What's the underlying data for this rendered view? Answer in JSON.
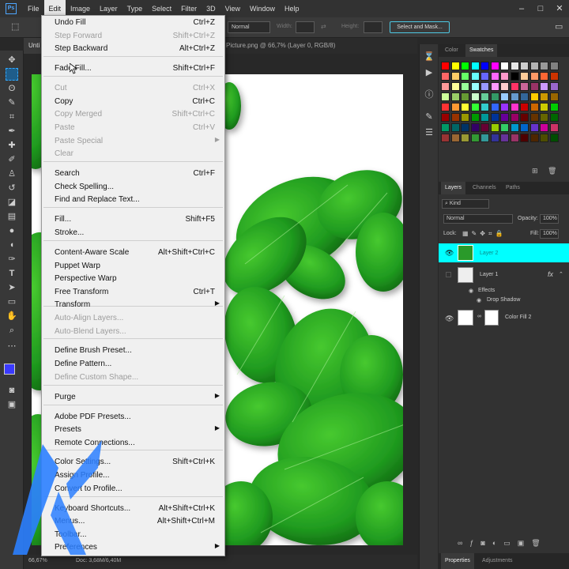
{
  "menubar": {
    "logo": "Ps",
    "items": [
      "File",
      "Edit",
      "Image",
      "Layer",
      "Type",
      "Select",
      "Filter",
      "3D",
      "View",
      "Window",
      "Help"
    ]
  },
  "options": {
    "mode": "Normal",
    "width_label": "Width:",
    "height_label": "Height:",
    "select_mask": "Select and Mask..."
  },
  "tabs": {
    "doc1": "Unti",
    "doc2": "Picture.png @ 66,7% (Layer 0, RGB/8)"
  },
  "status": {
    "zoom": "66,67%",
    "doc": "Doc: 3,68M/6,40M"
  },
  "panels": {
    "color_tab": "Color",
    "swatches_tab": "Swatches",
    "layers_tab": "Layers",
    "channels_tab": "Channels",
    "paths_tab": "Paths",
    "kind": "Kind",
    "blend": "Normal",
    "opacity_label": "Opacity:",
    "opacity_value": "100%",
    "lock_label": "Lock:",
    "fill_label": "Fill:",
    "fill_value": "100%",
    "properties_tab": "Properties",
    "adjustments_tab": "Adjustments"
  },
  "layers": [
    {
      "name": "Layer 2",
      "selected": true
    },
    {
      "name": "Layer 1",
      "fx": "fx"
    },
    {
      "name": "Effects"
    },
    {
      "name": "Drop Shadow"
    },
    {
      "name": "Color Fill 2"
    }
  ],
  "swatch_colors": [
    [
      "#ff0000",
      "#ffff00",
      "#00ff00",
      "#00ffff",
      "#0000ff",
      "#ff00ff",
      "#ffffff",
      "#e6e6e6",
      "#cccccc",
      "#b3b3b3",
      "#999999",
      "#808080"
    ],
    [
      "#ff6666",
      "#ffcc66",
      "#66ff66",
      "#66ffff",
      "#6666ff",
      "#ff66ff",
      "#ff99cc",
      "#000000",
      "#ffcc99",
      "#ff9966",
      "#ff6633",
      "#cc3300"
    ],
    [
      "#ff9999",
      "#ffff99",
      "#99ff99",
      "#99ffff",
      "#9999ff",
      "#ff99ff",
      "#ffcccc",
      "#ff3366",
      "#cc6699",
      "#993366",
      "#cc99ff",
      "#9966cc"
    ],
    [
      "#ccff99",
      "#99cc66",
      "#669933",
      "#ccffcc",
      "#66cc99",
      "#339966",
      "#99ccff",
      "#6699cc",
      "#336699",
      "#ffcc00",
      "#cc9900",
      "#996600"
    ],
    [
      "#ff3333",
      "#ff9933",
      "#ffff33",
      "#33ff33",
      "#33cccc",
      "#3366ff",
      "#9933ff",
      "#ff33cc",
      "#cc0000",
      "#cc6600",
      "#cccc00",
      "#00cc00"
    ],
    [
      "#990000",
      "#993300",
      "#999900",
      "#009900",
      "#009999",
      "#003399",
      "#660099",
      "#990066",
      "#660000",
      "#663300",
      "#666600",
      "#006600"
    ],
    [
      "#009966",
      "#006666",
      "#003366",
      "#330066",
      "#660033",
      "#99cc00",
      "#33cc66",
      "#0099cc",
      "#0066cc",
      "#6633cc",
      "#cc0099",
      "#cc3366"
    ],
    [
      "#993333",
      "#996633",
      "#999933",
      "#339933",
      "#339999",
      "#333399",
      "#663399",
      "#993366",
      "#4d0000",
      "#4d2600",
      "#4d4d00",
      "#004d00"
    ]
  ],
  "menu": {
    "items": [
      {
        "label": "Undo Fill",
        "shortcut": "Ctrl+Z"
      },
      {
        "label": "Step Forward",
        "shortcut": "Shift+Ctrl+Z",
        "disabled": true
      },
      {
        "label": "Step Backward",
        "shortcut": "Alt+Ctrl+Z"
      },
      {
        "label": "Fade Fill...",
        "shortcut": "Shift+Ctrl+F"
      },
      {
        "label": "Cut",
        "shortcut": "Ctrl+X",
        "disabled": true
      },
      {
        "label": "Copy",
        "shortcut": "Ctrl+C"
      },
      {
        "label": "Copy Merged",
        "shortcut": "Shift+Ctrl+C",
        "disabled": true
      },
      {
        "label": "Paste",
        "shortcut": "Ctrl+V",
        "disabled": true
      },
      {
        "label": "Paste Special",
        "disabled": true
      },
      {
        "label": "Clear",
        "disabled": true
      },
      {
        "label": "Search",
        "shortcut": "Ctrl+F"
      },
      {
        "label": "Check Spelling..."
      },
      {
        "label": "Find and Replace Text..."
      },
      {
        "label": "Fill...",
        "shortcut": "Shift+F5"
      },
      {
        "label": "Stroke..."
      },
      {
        "label": "Content-Aware Scale",
        "shortcut": "Alt+Shift+Ctrl+C"
      },
      {
        "label": "Puppet Warp"
      },
      {
        "label": "Perspective Warp"
      },
      {
        "label": "Free Transform",
        "shortcut": "Ctrl+T"
      },
      {
        "label": "Transform"
      },
      {
        "label": "Auto-Align Layers...",
        "disabled": true
      },
      {
        "label": "Auto-Blend Layers...",
        "disabled": true
      },
      {
        "label": "Define Brush Preset..."
      },
      {
        "label": "Define Pattern..."
      },
      {
        "label": "Define Custom Shape...",
        "disabled": true
      },
      {
        "label": "Purge"
      },
      {
        "label": "Adobe PDF Presets..."
      },
      {
        "label": "Presets"
      },
      {
        "label": "Remote Connections..."
      },
      {
        "label": "Color Settings...",
        "shortcut": "Shift+Ctrl+K"
      },
      {
        "label": "Assign Profile..."
      },
      {
        "label": "Convert to Profile..."
      },
      {
        "label": "Keyboard Shortcuts...",
        "shortcut": "Alt+Shift+Ctrl+K"
      },
      {
        "label": "Menus...",
        "shortcut": "Alt+Shift+Ctrl+M"
      },
      {
        "label": "Toolbar..."
      },
      {
        "label": "Preferences"
      }
    ]
  },
  "colors": {
    "accent": "#31a8ff",
    "selected_layer": "#00ffff",
    "leaf_dark": "#1a7a1a",
    "leaf_light": "#3fbf2a",
    "watermark": "#2b7fff"
  }
}
